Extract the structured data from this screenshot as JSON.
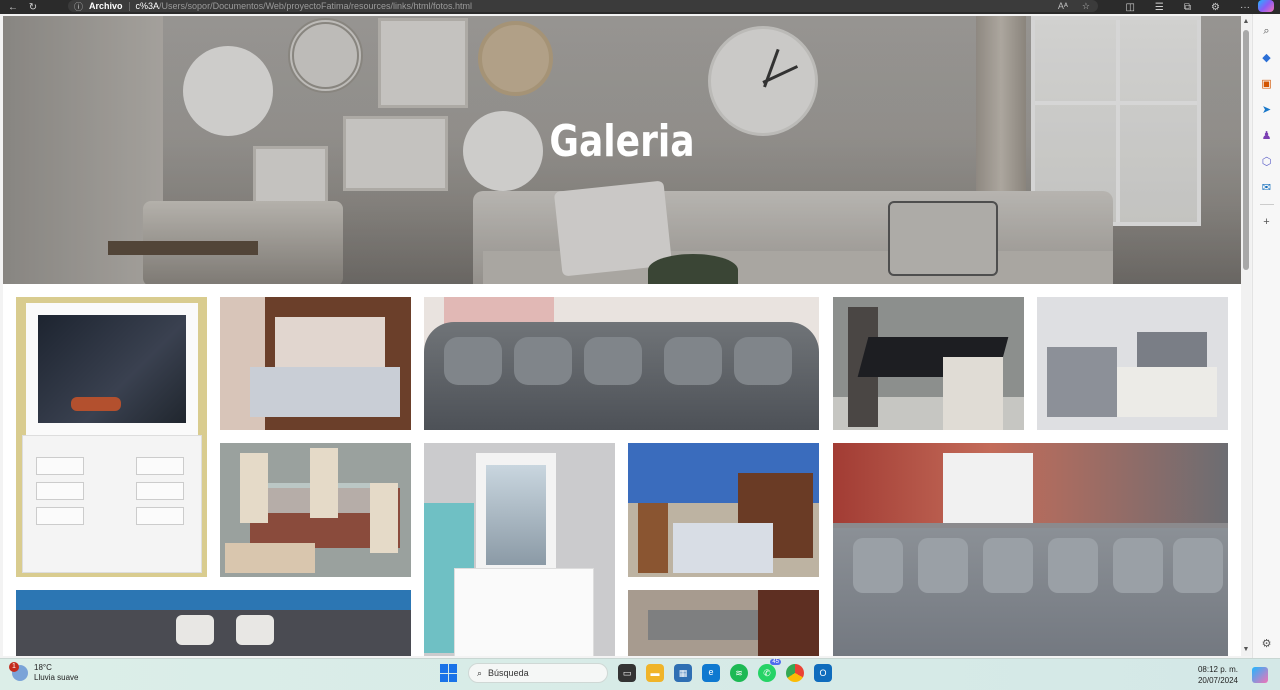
{
  "browser": {
    "archivo_label": "Archivo",
    "url_strong": "c%3A",
    "url_rest": "/Users/sopor/Documentos/Web/proyectoFatima/resources/links/html/fotos.html"
  },
  "page": {
    "title": "Galeria"
  },
  "gallery": [
    {
      "name": "vanity-white-mirror"
    },
    {
      "name": "bedroom-set-light"
    },
    {
      "name": "grey-sectional-sofa"
    },
    {
      "name": "dining-set-black"
    },
    {
      "name": "bedroom-set-grey"
    },
    {
      "name": "dining-set-glass"
    },
    {
      "name": "vanity-white-2"
    },
    {
      "name": "bedroom-set-wood"
    },
    {
      "name": "grey-sectional-large"
    },
    {
      "name": "dark-sectional-sofa"
    },
    {
      "name": "bed-headboard"
    }
  ],
  "taskbar": {
    "weather_temp": "18°C",
    "weather_desc": "Lluvia suave",
    "weather_badge": "1",
    "search_placeholder": "Búsqueda",
    "whatsapp_count": "45",
    "time": "08:12 p. m.",
    "date": "20/07/2024"
  },
  "colors": {
    "accent": "#1a73e8",
    "taskbar_bg": "#d7ebe7"
  }
}
